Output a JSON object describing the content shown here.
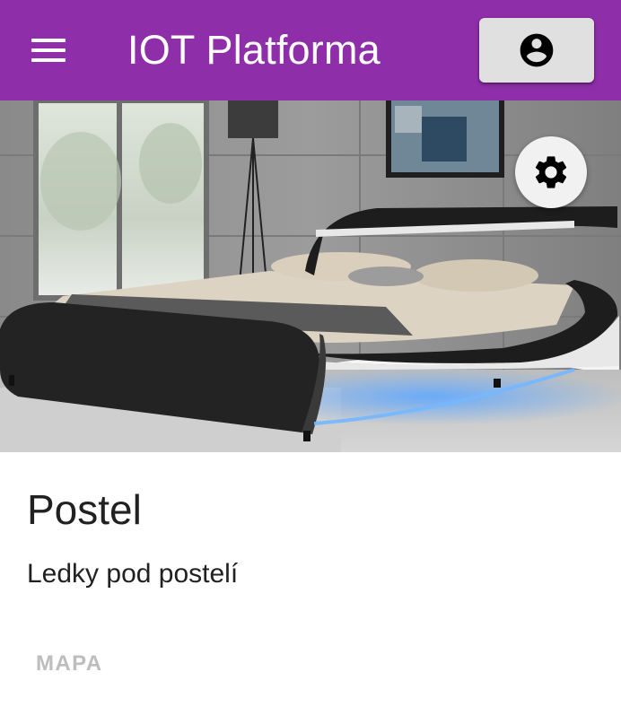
{
  "app": {
    "title": "IOT Platforma",
    "brand_color": "#8e2fa9"
  },
  "icons": {
    "menu": "menu-icon",
    "account": "account-circle-icon",
    "settings": "gear-icon"
  },
  "card": {
    "title": "Postel",
    "description": "Ledky pod postelí",
    "actions": {
      "map_label": "MAPA",
      "map_disabled": true
    }
  }
}
